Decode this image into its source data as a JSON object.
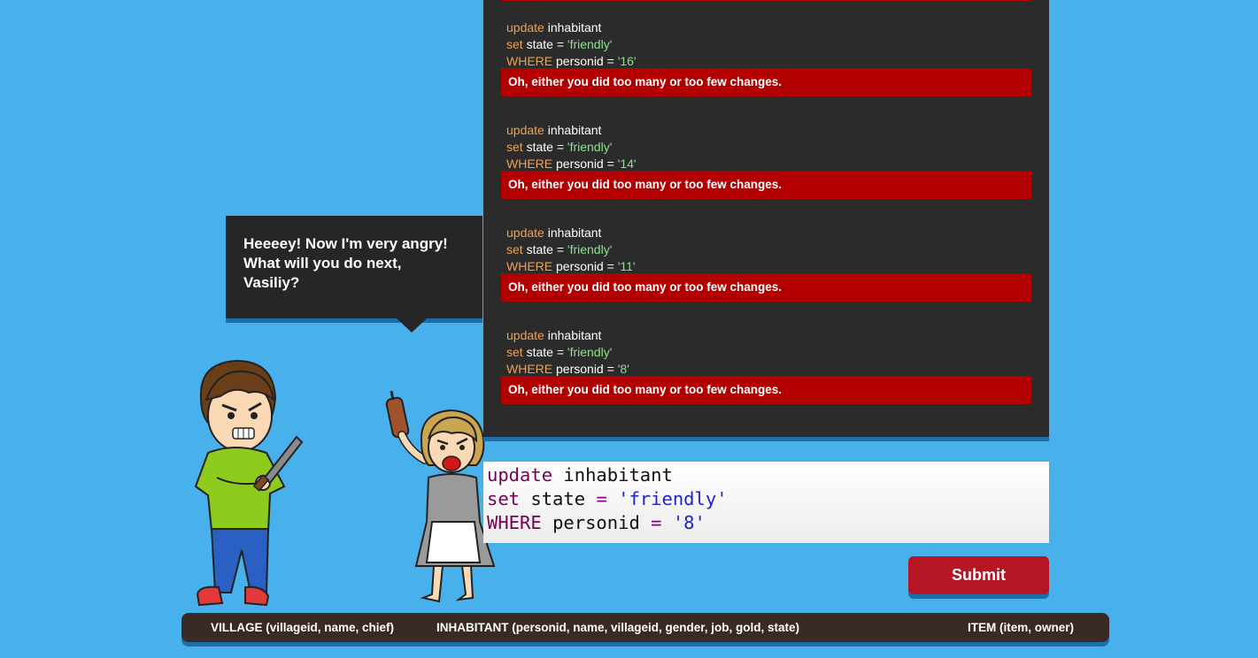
{
  "speech": {
    "text": "Heeeey! Now I'm very angry!\nWhat will you do next,\nVasiliy?"
  },
  "log": {
    "entries": [
      {
        "kw_update": "update",
        "table": "inhabitant",
        "kw_set": "set",
        "set_lhs": "state =",
        "set_val": "'friendly'",
        "kw_where": "WHERE",
        "where_lhs": "personid =",
        "where_val": "'16'",
        "error": "Oh, either you did too many or too few changes."
      },
      {
        "kw_update": "update",
        "table": "inhabitant",
        "kw_set": "set",
        "set_lhs": "state =",
        "set_val": "'friendly'",
        "kw_where": "WHERE",
        "where_lhs": "personid =",
        "where_val": "'14'",
        "error": "Oh, either you did too many or too few changes."
      },
      {
        "kw_update": "update",
        "table": "inhabitant",
        "kw_set": "set",
        "set_lhs": "state =",
        "set_val": "'friendly'",
        "kw_where": "WHERE",
        "where_lhs": "personid =",
        "where_val": "'11'",
        "error": "Oh, either you did too many or too few changes."
      },
      {
        "kw_update": "update",
        "table": "inhabitant",
        "kw_set": "set",
        "set_lhs": "state =",
        "set_val": "'friendly'",
        "kw_where": "WHERE",
        "where_lhs": "personid =",
        "where_val": "'8'",
        "error": "Oh, either you did too many or too few changes."
      }
    ]
  },
  "editor": {
    "kw_update": "update",
    "table": "inhabitant",
    "kw_set": "set",
    "set_col": "state",
    "eq": "=",
    "set_val": "'friendly'",
    "kw_where": "WHERE",
    "where_col": "personid",
    "where_val": "'8'"
  },
  "submit": {
    "label": "Submit"
  },
  "schema": {
    "village": "VILLAGE (villageid, name, chief)",
    "inhabitant": "INHABITANT (personid, name, villageid, gender, job, gold, state)",
    "item": "ITEM (item, owner)"
  },
  "colors": {
    "background": "#48b0ea",
    "panel": "#2b2b2b",
    "error": "#b20000",
    "submit": "#b61523",
    "schema_bar": "#3a2a25"
  }
}
